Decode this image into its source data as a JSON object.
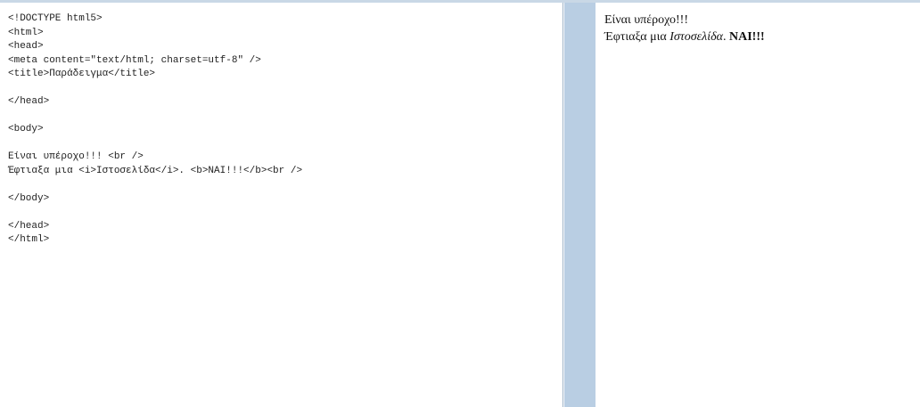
{
  "editor": {
    "lines": [
      "<!DOCTYPE html5>",
      "<html>",
      "<head>",
      "<meta content=\"text/html; charset=utf-8\" />",
      "<title>Παράδειγμα</title>",
      "",
      "</head>",
      "",
      "<body>",
      "",
      "Είναι υπέροχο!!! <br />",
      "Έφτιαξα μια <i>Ιστοσελίδα</i>. <b>ΝΑΙ!!!</b><br />",
      "",
      "</body>",
      "",
      "</head>",
      "</html>"
    ]
  },
  "preview": {
    "line1": "Είναι υπέροχο!!!",
    "line2_prefix": "Έφτιαξα μια ",
    "line2_italic": "Ιστοσελίδα",
    "line2_mid": ". ",
    "line2_bold": "ΝΑΙ!!!"
  },
  "colors": {
    "splitter": "#b9cee3",
    "top_rule": "#c9d8e6",
    "code_text": "#222222"
  }
}
